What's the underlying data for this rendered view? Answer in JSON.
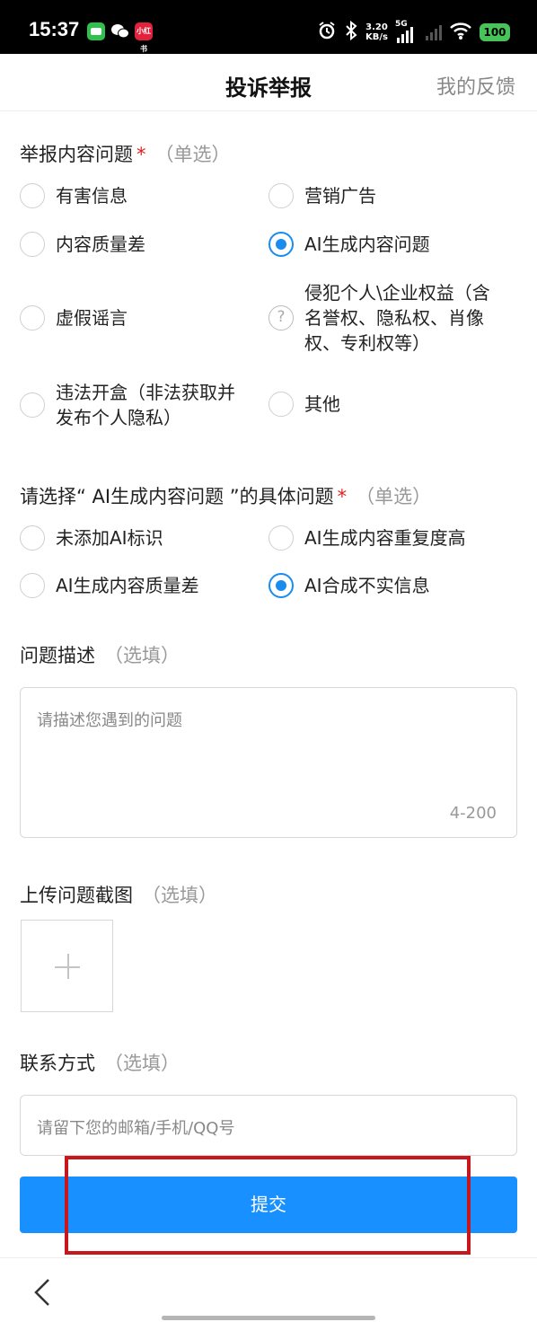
{
  "status_bar": {
    "time": "15:37",
    "app_badge_red": "小红书",
    "net_speed_value": "3.20",
    "net_speed_unit": "KB/s",
    "network": "5G",
    "battery": "100"
  },
  "header": {
    "title": "投诉举报",
    "feedback_link": "我的反馈"
  },
  "section1": {
    "title": "举报内容问题",
    "required_mark": "*",
    "hint": "（单选）",
    "options": [
      {
        "label": "有害信息",
        "checked": false
      },
      {
        "label": "营销广告",
        "checked": false
      },
      {
        "label": "内容质量差",
        "checked": false
      },
      {
        "label": "AI生成内容问题",
        "checked": true
      },
      {
        "label": "虚假谣言",
        "checked": false
      },
      {
        "label": "侵犯个人\\企业权益（含名誉权、隐私权、肖像权、专利权等）",
        "line1": "侵犯个人\\企业权益（含",
        "line2": "名誉权、隐私权、肖像",
        "line3": "权、专利权等）",
        "checked": false,
        "icon": "question-mark-icon"
      },
      {
        "label": "违法开盒（非法获取并发布个人隐私）",
        "line1": "违法开盒（非法获取并",
        "line2": "发布个人隐私）",
        "checked": false
      },
      {
        "label": "其他",
        "checked": false
      }
    ]
  },
  "section2": {
    "title": "请选择“ AI生成内容问题 ”的具体问题",
    "required_mark": "*",
    "hint": "（单选）",
    "options": [
      {
        "label": "未添加AI标识",
        "checked": false
      },
      {
        "label": "AI生成内容重复度高",
        "checked": false
      },
      {
        "label": "AI生成内容质量差",
        "checked": false
      },
      {
        "label": "AI合成不实信息",
        "checked": true
      }
    ]
  },
  "description": {
    "title": "问题描述",
    "hint": "（选填）",
    "placeholder": "请描述您遇到的问题",
    "counter": "4-200"
  },
  "upload": {
    "title": "上传问题截图",
    "hint": "（选填）"
  },
  "contact": {
    "title": "联系方式",
    "hint": "（选填）",
    "placeholder": "请留下您的邮箱/手机/QQ号"
  },
  "submit": {
    "label": "提交"
  },
  "colors": {
    "accent": "#1890ff",
    "radio_checked": "#1a8cf0",
    "required": "#e02020",
    "highlight": "#c8161d"
  }
}
